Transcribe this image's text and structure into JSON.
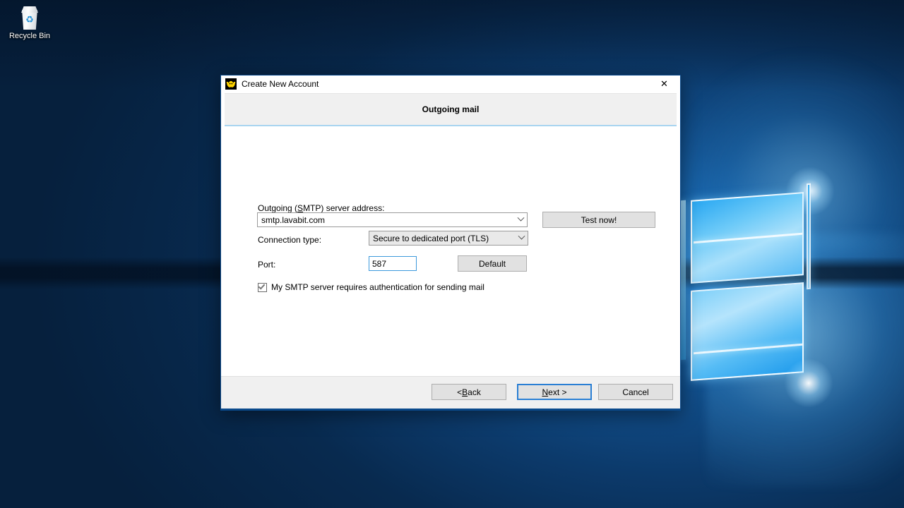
{
  "desktop": {
    "icons": [
      {
        "name": "recycle-bin",
        "label": "Recycle Bin",
        "glyph": "recycle-icon"
      }
    ],
    "wallpaper_colors": {
      "deep_blue": "#07213e",
      "mid_blue": "#12518f",
      "bright_blue": "#1b74c4",
      "logo_light": "#a9e0fb"
    }
  },
  "dialog": {
    "title": "Create New Account",
    "app_icon": "bat-icon",
    "close_label": "✕",
    "header_title": "Outgoing mail",
    "accent_color": "#0a4a8c",
    "header_rule_color": "#a8d4f0",
    "form": {
      "server_label_pre": "Outgoing (",
      "server_label_accel": "S",
      "server_label_post": "MTP) server address:",
      "server_label_full": "Outgoing (SMTP) server address:",
      "server_value": "smtp.lavabit.com",
      "connection_label": "Connection type:",
      "connection_value": "Secure to dedicated port (TLS)",
      "port_label": "Port:",
      "port_value": "587",
      "default_button": "Default",
      "test_button": "Test now!",
      "auth_checkbox_label": "My SMTP server requires authentication for sending mail",
      "auth_checkbox_checked": true
    },
    "footer": {
      "back_pre": "<  ",
      "back_accel": "B",
      "back_post": "ack",
      "back_full": "<  Back",
      "next_accel": "N",
      "next_post": "ext  >",
      "next_full": "Next  >",
      "cancel_label": "Cancel",
      "focused_button": "next-button"
    }
  }
}
